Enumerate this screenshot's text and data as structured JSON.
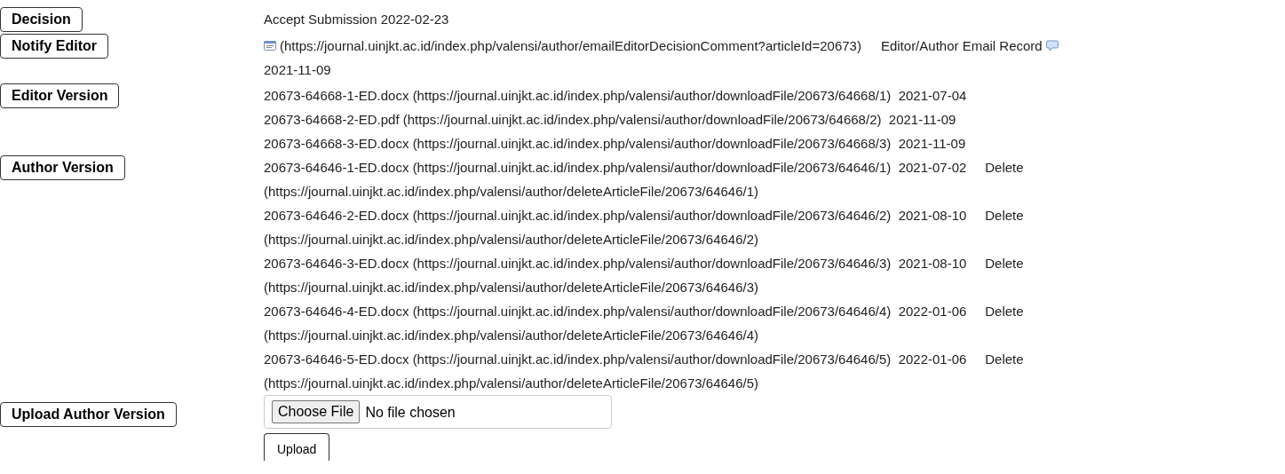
{
  "decision": {
    "label": "Decision",
    "value": "Accept Submission 2022-02-23"
  },
  "notify_editor": {
    "label": "Notify Editor",
    "url": "(https://journal.uinjkt.ac.id/index.php/valensi/author/emailEditorDecisionComment?articleId=20673)",
    "record_link": "Editor/Author Email Record",
    "date": "2021-11-09"
  },
  "editor_version": {
    "label": "Editor Version",
    "files": [
      {
        "name": "20673-64668-1-ED.docx",
        "url": "(https://journal.uinjkt.ac.id/index.php/valensi/author/downloadFile/20673/64668/1)",
        "date": "2021-07-04"
      },
      {
        "name": "20673-64668-2-ED.pdf",
        "url": "(https://journal.uinjkt.ac.id/index.php/valensi/author/downloadFile/20673/64668/2)",
        "date": "2021-11-09"
      },
      {
        "name": "20673-64668-3-ED.docx",
        "url": "(https://journal.uinjkt.ac.id/index.php/valensi/author/downloadFile/20673/64668/3)",
        "date": "2021-11-09"
      }
    ]
  },
  "author_version": {
    "label": "Author Version",
    "files": [
      {
        "name": "20673-64646-1-ED.docx",
        "url": "(https://journal.uinjkt.ac.id/index.php/valensi/author/downloadFile/20673/64646/1)",
        "date": "2021-07-02",
        "delete": "Delete",
        "delete_url": "(https://journal.uinjkt.ac.id/index.php/valensi/author/deleteArticleFile/20673/64646/1)"
      },
      {
        "name": "20673-64646-2-ED.docx",
        "url": "(https://journal.uinjkt.ac.id/index.php/valensi/author/downloadFile/20673/64646/2)",
        "date": "2021-08-10",
        "delete": "Delete",
        "delete_url": "(https://journal.uinjkt.ac.id/index.php/valensi/author/deleteArticleFile/20673/64646/2)"
      },
      {
        "name": "20673-64646-3-ED.docx",
        "url": "(https://journal.uinjkt.ac.id/index.php/valensi/author/downloadFile/20673/64646/3)",
        "date": "2021-08-10",
        "delete": "Delete",
        "delete_url": "(https://journal.uinjkt.ac.id/index.php/valensi/author/deleteArticleFile/20673/64646/3)"
      },
      {
        "name": "20673-64646-4-ED.docx",
        "url": "(https://journal.uinjkt.ac.id/index.php/valensi/author/downloadFile/20673/64646/4)",
        "date": "2022-01-06",
        "delete": "Delete",
        "delete_url": "(https://journal.uinjkt.ac.id/index.php/valensi/author/deleteArticleFile/20673/64646/4)"
      },
      {
        "name": "20673-64646-5-ED.docx",
        "url": "(https://journal.uinjkt.ac.id/index.php/valensi/author/downloadFile/20673/64646/5)",
        "date": "2022-01-06",
        "delete": "Delete",
        "delete_url": "(https://journal.uinjkt.ac.id/index.php/valensi/author/deleteArticleFile/20673/64646/5)"
      }
    ]
  },
  "upload": {
    "label": "Upload Author Version",
    "choose_button": "Choose File",
    "file_status": "No file chosen",
    "upload_button": "Upload"
  }
}
